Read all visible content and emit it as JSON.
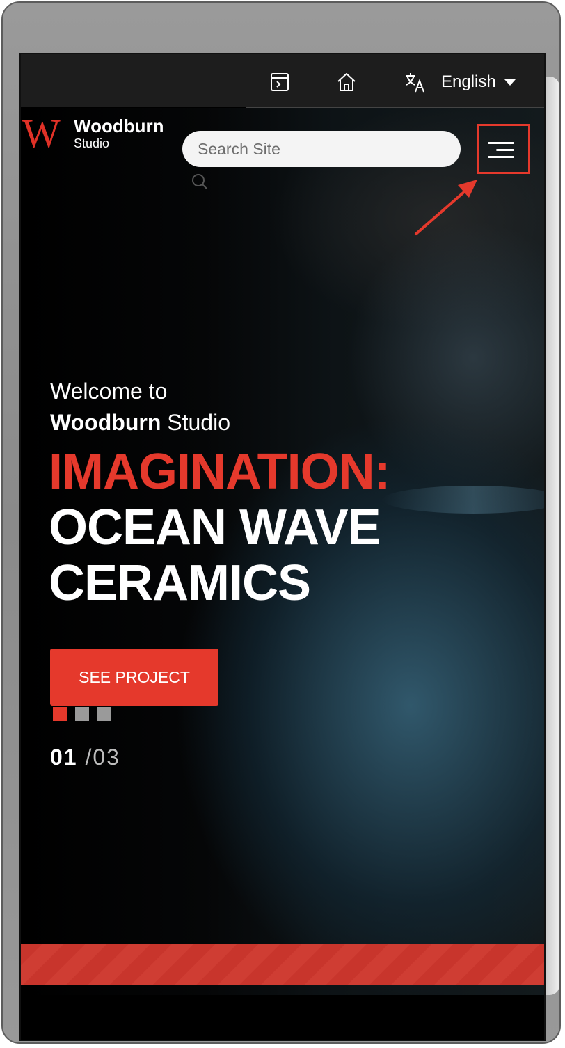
{
  "topbar": {
    "icons": [
      "terminal-icon",
      "home-icon",
      "translate-icon"
    ],
    "language_label": "English"
  },
  "brand": {
    "name": "Woodburn",
    "subtitle": "Studio",
    "logo_letter": "W"
  },
  "search": {
    "placeholder": "Search Site"
  },
  "hero": {
    "welcome_line1": "Welcome to",
    "welcome_brand": "Woodburn",
    "welcome_brand_suffix": " Studio",
    "headline_red": "IMAGINATION:",
    "headline_white": "OCEAN WAVE CERAMICS",
    "cta_label": "SEE PROJECT"
  },
  "slider": {
    "current": "01",
    "separator": "/",
    "total": "03",
    "active_index": 0,
    "count": 3
  },
  "colors": {
    "accent": "#e5392c",
    "highlight_box": "#e5392c",
    "topbar_bg": "#1d1d1d"
  }
}
